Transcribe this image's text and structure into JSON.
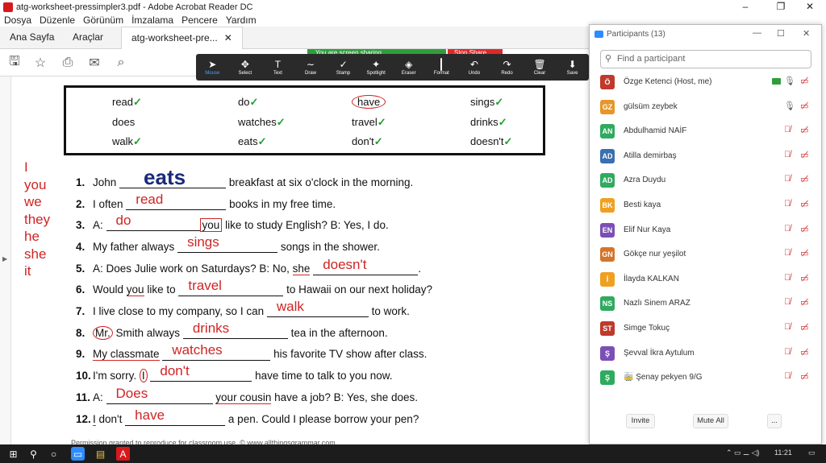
{
  "window": {
    "title": "atg-worksheet-pressimpler3.pdf - Adobe Acrobat Reader DC"
  },
  "menu": [
    "Dosya",
    "Düzenle",
    "Görünüm",
    "İmzalama",
    "Pencere",
    "Yardım"
  ],
  "tabs": [
    {
      "label": "Ana Sayfa"
    },
    {
      "label": "Araçlar"
    },
    {
      "label": "atg-worksheet-pre..."
    }
  ],
  "share_banner": "You are screen sharing",
  "stop_share": "Stop Share",
  "annotation_tools": [
    {
      "label": "Mouse",
      "icon": "➤",
      "active": true
    },
    {
      "label": "Select",
      "icon": "✥"
    },
    {
      "label": "Text",
      "icon": "T"
    },
    {
      "label": "Draw",
      "icon": "∼"
    },
    {
      "label": "Stamp",
      "icon": "✓"
    },
    {
      "label": "Spotlight",
      "icon": "✦"
    },
    {
      "label": "Eraser",
      "icon": "◈"
    },
    {
      "label": "Format",
      "icon": ""
    },
    {
      "label": "Undo",
      "icon": "↶"
    },
    {
      "label": "Redo",
      "icon": "↷"
    },
    {
      "label": "Clear",
      "icon": "🗑"
    },
    {
      "label": "Save",
      "icon": "⬇"
    }
  ],
  "wordbox": [
    [
      "read",
      "do",
      "have",
      "sings"
    ],
    [
      "does",
      "watches",
      "travel",
      "drinks"
    ],
    [
      "walk",
      "eats",
      "don't",
      "doesn't"
    ]
  ],
  "pronouns": [
    "I",
    "you",
    "we",
    "they",
    "he",
    "she",
    "it"
  ],
  "questions": [
    {
      "n": "1.",
      "pre": "John",
      "ans": "eats",
      "post": "breakfast at six o'clock in the morning."
    },
    {
      "n": "2.",
      "pre": "I often",
      "ans": "read",
      "post": "books in my free time."
    },
    {
      "n": "3.",
      "pre": "A:",
      "ans": "do",
      "mid": "you",
      "post": "like to study English?   B: Yes, I do."
    },
    {
      "n": "4.",
      "pre": "My father always",
      "ans": "sings",
      "post": "songs in the shower."
    },
    {
      "n": "5.",
      "pre": "A: Does Julie work on Saturdays?  B: No,",
      "mid": "she",
      "ans": "doesn't",
      "post": "."
    },
    {
      "n": "6.",
      "pre": "Would",
      "mid": "you",
      "pre2": "like to",
      "ans": "travel",
      "post": "to Hawaii on our next holiday?"
    },
    {
      "n": "7.",
      "pre": "I live close to my company, so I can",
      "ans": "walk",
      "post": "to work."
    },
    {
      "n": "8.",
      "mid": "Mr.",
      "pre2": "Smith always",
      "ans": "drinks",
      "post": "tea in the afternoon."
    },
    {
      "n": "9.",
      "mid": "My classmate",
      "ans": "watches",
      "post": "his favorite TV show after class."
    },
    {
      "n": "10.",
      "pre": "I'm sorry.",
      "mid": "I",
      "ans": "don't",
      "post": "have time to talk to you now."
    },
    {
      "n": "11.",
      "pre": "A:",
      "ans": "Does",
      "mid": "your cousin",
      "post": "have a job?  B: Yes, she does."
    },
    {
      "n": "12.",
      "mid": "I",
      "pre2": "don't",
      "ans": "have",
      "post": "a pen.  Could I please borrow your pen?"
    }
  ],
  "footer": "Permission granted to reproduce for classroom use.  © www.allthingsgrammar.com",
  "participants_panel": {
    "title": "Participants (13)",
    "search_placeholder": "Find a participant",
    "participants": [
      {
        "initials": "Ö",
        "name": "Özge Ketenci (Host, me)",
        "color": "#c0392b",
        "mic": "on",
        "sharing": true
      },
      {
        "initials": "GZ",
        "name": "gülsüm zeybek",
        "color": "#e6962b",
        "mic": "on"
      },
      {
        "initials": "AN",
        "name": "Abdulhamid NAİF",
        "color": "#2faa5f",
        "mic": "off"
      },
      {
        "initials": "AD",
        "name": "Atilla demirbaş",
        "color": "#3a6fb0",
        "mic": "off"
      },
      {
        "initials": "AD",
        "name": "Azra Duydu",
        "color": "#2faa5f",
        "mic": "off"
      },
      {
        "initials": "BK",
        "name": "Besti  kaya",
        "color": "#f0a020",
        "mic": "off"
      },
      {
        "initials": "EN",
        "name": "Elif Nur Kaya",
        "color": "#7b4fb5",
        "mic": "off"
      },
      {
        "initials": "GN",
        "name": "Gökçe nur yeşilot",
        "color": "#d5742a",
        "mic": "off"
      },
      {
        "initials": "İ",
        "name": "İlayda KALKAN",
        "color": "#f0a020",
        "mic": "off"
      },
      {
        "initials": "NS",
        "name": "Nazlı Sinem ARAZ",
        "color": "#2faa5f",
        "mic": "off"
      },
      {
        "initials": "ST",
        "name": "Simge Tokuç",
        "color": "#c0392b",
        "mic": "off"
      },
      {
        "initials": "Ş",
        "name": "Şevval İkra Aytulum",
        "color": "#7b4fb5",
        "mic": "off"
      },
      {
        "initials": "Ş",
        "name": "🚋 Şenay pekyen 9/G",
        "color": "#2faa5f",
        "mic": "off"
      }
    ],
    "invite": "Invite",
    "mute_all": "Mute All",
    "more": "..."
  },
  "taskbar": {
    "time": "11:21"
  }
}
